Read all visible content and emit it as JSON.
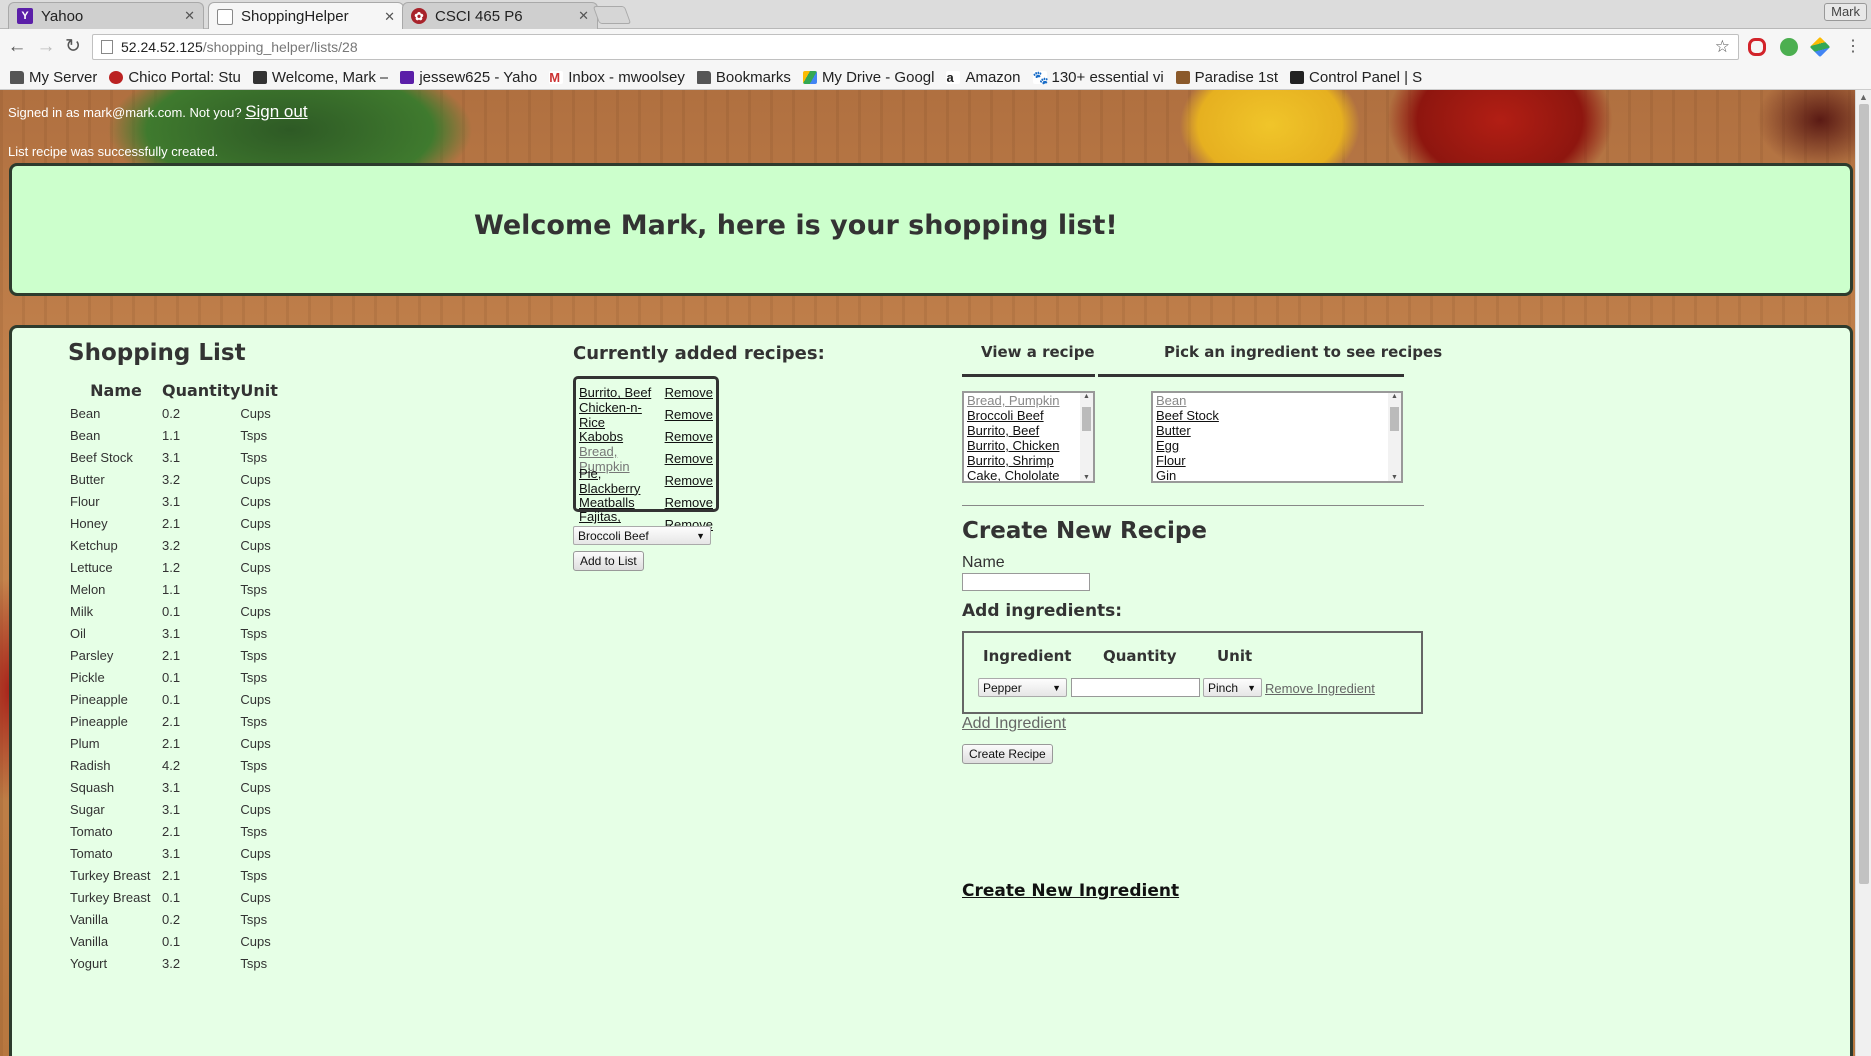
{
  "browser": {
    "tabs": [
      {
        "label": "Yahoo",
        "icon": "yahoo-icon",
        "active": false
      },
      {
        "label": "ShoppingHelper",
        "icon": "page-icon",
        "active": true
      },
      {
        "label": "CSCI 465 P6",
        "icon": "csci-icon",
        "active": false
      }
    ],
    "user": "Mark",
    "url_host": "52.24.52.125",
    "url_path": "/shopping_helper/lists/28",
    "bookmarks": [
      {
        "label": "My Server",
        "icon": "folder-icon"
      },
      {
        "label": "Chico Portal: Stu",
        "icon": "chico-icon"
      },
      {
        "label": "Welcome, Mark –",
        "icon": "bb-icon"
      },
      {
        "label": "jessew625 - Yaho",
        "icon": "mail-icon"
      },
      {
        "label": "Inbox - mwoolsey",
        "icon": "gmail-icon"
      },
      {
        "label": "Bookmarks",
        "icon": "folder-icon"
      },
      {
        "label": "My Drive - Googl",
        "icon": "drive-icon"
      },
      {
        "label": "Amazon",
        "icon": "amazon-icon"
      },
      {
        "label": "130+ essential vi",
        "icon": "paw-icon"
      },
      {
        "label": "Paradise 1st",
        "icon": "bank-icon"
      },
      {
        "label": "Control Panel | S",
        "icon": "cp-icon"
      }
    ]
  },
  "session": {
    "signed_in_text": "Signed in as mark@mark.com. Not you?",
    "sign_out": "Sign out",
    "notice": "List recipe was successfully created."
  },
  "banner": {
    "title": "Welcome Mark, here is your shopping list!"
  },
  "shopping_list": {
    "title": "Shopping List",
    "columns": [
      "Name",
      "Quantity",
      "Unit"
    ],
    "rows": [
      [
        "Bean",
        "0.2",
        "Cups"
      ],
      [
        "Bean",
        "1.1",
        "Tsps"
      ],
      [
        "Beef Stock",
        "3.1",
        "Tsps"
      ],
      [
        "Butter",
        "3.2",
        "Cups"
      ],
      [
        "Flour",
        "3.1",
        "Cups"
      ],
      [
        "Honey",
        "2.1",
        "Cups"
      ],
      [
        "Ketchup",
        "3.2",
        "Cups"
      ],
      [
        "Lettuce",
        "1.2",
        "Cups"
      ],
      [
        "Melon",
        "1.1",
        "Tsps"
      ],
      [
        "Milk",
        "0.1",
        "Cups"
      ],
      [
        "Oil",
        "3.1",
        "Tsps"
      ],
      [
        "Parsley",
        "2.1",
        "Tsps"
      ],
      [
        "Pickle",
        "0.1",
        "Tsps"
      ],
      [
        "Pineapple",
        "0.1",
        "Cups"
      ],
      [
        "Pineapple",
        "2.1",
        "Tsps"
      ],
      [
        "Plum",
        "2.1",
        "Cups"
      ],
      [
        "Radish",
        "4.2",
        "Tsps"
      ],
      [
        "Squash",
        "3.1",
        "Cups"
      ],
      [
        "Sugar",
        "3.1",
        "Cups"
      ],
      [
        "Tomato",
        "2.1",
        "Tsps"
      ],
      [
        "Tomato",
        "3.1",
        "Cups"
      ],
      [
        "Turkey Breast",
        "2.1",
        "Tsps"
      ],
      [
        "Turkey Breast",
        "0.1",
        "Cups"
      ],
      [
        "Vanilla",
        "0.2",
        "Tsps"
      ],
      [
        "Vanilla",
        "0.1",
        "Cups"
      ],
      [
        "Yogurt",
        "3.2",
        "Tsps"
      ]
    ]
  },
  "added_recipes": {
    "title": "Currently added recipes:",
    "remove_label": "Remove",
    "items": [
      "Burrito, Beef",
      "Chicken-n-Rice",
      "Kabobs",
      "Bread, Pumpkin",
      "Pie, Blackberry",
      "Meatballs",
      "Fajitas, Chicken"
    ],
    "select_value": "Broccoli Beef",
    "add_button": "Add to List"
  },
  "view_recipe": {
    "title": "View a recipe",
    "items": [
      "Bread, Pumpkin",
      "Broccoli Beef",
      "Burrito, Beef",
      "Burrito, Chicken",
      "Burrito, Shrimp",
      "Cake, Chololate"
    ]
  },
  "pick_ingredient": {
    "title": "Pick an ingredient to see recipes",
    "items": [
      "Bean",
      "Beef Stock",
      "Butter",
      "Egg",
      "Flour",
      "Gin"
    ]
  },
  "create_recipe": {
    "title": "Create New Recipe",
    "name_label": "Name",
    "name_value": "",
    "add_ingredients_title": "Add ingredients:",
    "headers": [
      "Ingredient",
      "Quantity",
      "Unit"
    ],
    "ingredient_value": "Pepper",
    "quantity_value": "",
    "unit_value": "Pinch",
    "remove_ingredient": "Remove Ingredient",
    "add_ingredient": "Add Ingredient",
    "submit": "Create Recipe"
  },
  "create_ingredient": "Create New Ingredient",
  "colors": {
    "banner_bg": "#ccffcc",
    "panel_bg": "#e6ffe6",
    "border": "#2d3b2d"
  }
}
